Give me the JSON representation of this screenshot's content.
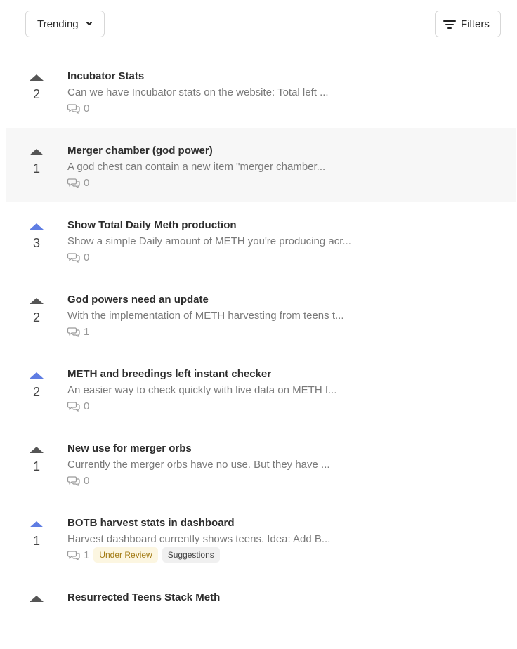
{
  "toolbar": {
    "sort_label": "Trending",
    "filter_label": "Filters"
  },
  "posts": [
    {
      "votes": "2",
      "voted": false,
      "title": "Incubator Stats",
      "excerpt": "Can we have Incubator stats on the website: Total left ...",
      "comments": "0",
      "tags": []
    },
    {
      "votes": "1",
      "voted": false,
      "title": "Merger chamber (god power)",
      "excerpt": "A god chest can contain a new item \"merger chamber...",
      "comments": "0",
      "tags": []
    },
    {
      "votes": "3",
      "voted": true,
      "title": "Show Total Daily Meth production",
      "excerpt": "Show a simple Daily amount of METH you're producing acr...",
      "comments": "0",
      "tags": []
    },
    {
      "votes": "2",
      "voted": false,
      "title": "God powers need an update",
      "excerpt": "With the implementation of METH harvesting from teens t...",
      "comments": "1",
      "tags": []
    },
    {
      "votes": "2",
      "voted": true,
      "title": "METH and breedings left instant checker",
      "excerpt": "An easier way to check quickly with live data on METH f...",
      "comments": "0",
      "tags": []
    },
    {
      "votes": "1",
      "voted": false,
      "title": "New use for merger orbs",
      "excerpt": "Currently the merger orbs have no use. But they have ...",
      "comments": "0",
      "tags": []
    },
    {
      "votes": "1",
      "voted": true,
      "title": "BOTB harvest stats in dashboard",
      "excerpt": "Harvest dashboard currently shows teens. Idea: Add B...",
      "comments": "1",
      "tags": [
        "Under Review",
        "Suggestions"
      ]
    },
    {
      "votes": "",
      "voted": false,
      "title": "Resurrected Teens Stack Meth",
      "excerpt": "",
      "comments": "",
      "tags": []
    }
  ],
  "colors": {
    "voted_arrow": "#5f7de3",
    "default_arrow": "#555555",
    "hover_row": "#f7f7f7",
    "under_review_bg": "#fcf6e1",
    "under_review_text": "#a27a13"
  },
  "icons": {
    "sort": "chevron-down-icon",
    "filter": "filter-lines-icon",
    "upvote": "triangle-up-icon",
    "comment": "speech-bubbles-icon"
  }
}
